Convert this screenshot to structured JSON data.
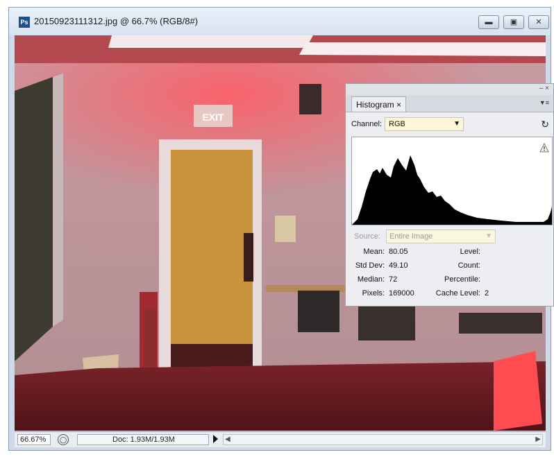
{
  "window": {
    "app_icon": "Ps",
    "title": "20150923111312.jpg @ 66.7% (RGB/8#)",
    "controls": {
      "minimize": "minimize-icon",
      "restore": "restore-icon",
      "close": "close-icon"
    }
  },
  "statusbar": {
    "zoom": "66.67%",
    "doc_info": "Doc: 1.93M/1.93M"
  },
  "histogram": {
    "tab_label": "Histogram",
    "tab_close": "×",
    "channel_label": "Channel:",
    "channel_value": "RGB",
    "source_label": "Source:",
    "source_value": "Entire Image",
    "stats": {
      "mean_label": "Mean:",
      "mean": "80.05",
      "stddev_label": "Std Dev:",
      "stddev": "49.10",
      "median_label": "Median:",
      "median": "72",
      "pixels_label": "Pixels:",
      "pixels": "169000",
      "level_label": "Level:",
      "level": "",
      "count_label": "Count:",
      "count": "",
      "percentile_label": "Percentile:",
      "percentile": "",
      "cache_label": "Cache Level:",
      "cache": "2"
    },
    "colors": {
      "graph_fill": "#000000",
      "select_bg": "#fdf7d8"
    }
  }
}
